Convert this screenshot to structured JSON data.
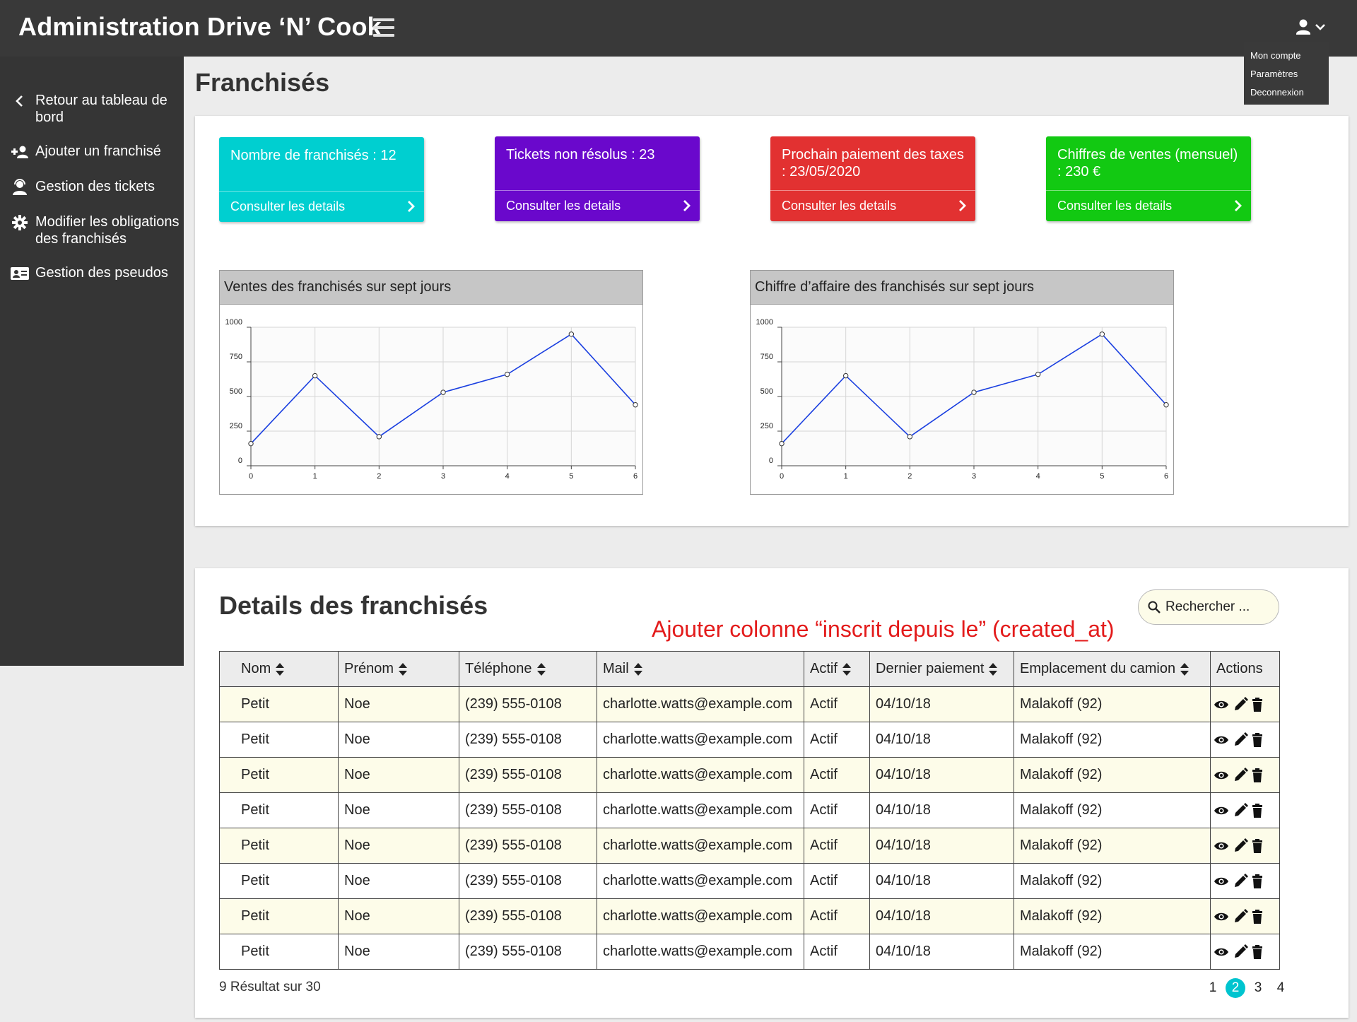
{
  "header": {
    "app_title": "Administration Drive ‘N’ Cook",
    "user_menu": [
      "Mon compte",
      "Paramètres",
      "Deconnexion"
    ]
  },
  "sidebar": {
    "items": [
      {
        "label": "Retour au tableau de bord",
        "icon": "chevron-left-icon"
      },
      {
        "label": "Ajouter un franchisé",
        "icon": "user-plus-icon"
      },
      {
        "label": "Gestion des tickets",
        "icon": "support-agent-icon"
      },
      {
        "label": "Modifier les obligations des franchisés",
        "icon": "gear-icon"
      },
      {
        "label": "Gestion des pseudos",
        "icon": "id-card-icon"
      }
    ]
  },
  "page": {
    "title": "Franchisés"
  },
  "cards": [
    {
      "title": "Nombre de franchisés : 12",
      "link": "Consulter les details",
      "color": "#00cfd0"
    },
    {
      "title": "Tickets non résolus : 23",
      "link": "Consulter les details",
      "color": "#6a08cc"
    },
    {
      "title": "Prochain paiement des taxes : 23/05/2020",
      "link": "Consulter les details",
      "color": "#e23131"
    },
    {
      "title": "Chiffres de ventes (mensuel) : 230 €",
      "link": "Consulter les details",
      "color": "#12c912"
    }
  ],
  "chart_data": [
    {
      "type": "line",
      "title": "Ventes des franchisés sur sept jours",
      "x": [
        0,
        1,
        2,
        3,
        4,
        5,
        6
      ],
      "series": [
        {
          "values": [
            160,
            650,
            210,
            530,
            660,
            950,
            440
          ]
        }
      ],
      "xlim": [
        0,
        6
      ],
      "ylim": [
        0,
        1000
      ],
      "yticks": [
        0,
        250,
        500,
        750,
        1000
      ],
      "grid": true,
      "line_color": "#1a3fe0"
    },
    {
      "type": "line",
      "title": "Chiffre d’affaire des franchisés sur sept jours",
      "x": [
        0,
        1,
        2,
        3,
        4,
        5,
        6
      ],
      "series": [
        {
          "values": [
            160,
            650,
            210,
            530,
            660,
            950,
            440
          ]
        }
      ],
      "xlim": [
        0,
        6
      ],
      "ylim": [
        0,
        1000
      ],
      "yticks": [
        0,
        250,
        500,
        750,
        1000
      ],
      "grid": true,
      "line_color": "#1a3fe0"
    }
  ],
  "details": {
    "title": "Details des franchisés",
    "annotation": "Ajouter colonne “inscrit depuis le” (created_at)",
    "search_placeholder": "Rechercher ...",
    "columns": [
      "Nom",
      "Prénom",
      "Téléphone",
      "Mail",
      "Actif",
      "Dernier paiement",
      "Emplacement du camion",
      "Actions"
    ],
    "rows": [
      [
        "Petit",
        "Noe",
        "(239) 555-0108",
        "charlotte.watts@example.com",
        "Actif",
        "04/10/18",
        "Malakoff (92)"
      ],
      [
        "Petit",
        "Noe",
        "(239) 555-0108",
        "charlotte.watts@example.com",
        "Actif",
        "04/10/18",
        "Malakoff (92)"
      ],
      [
        "Petit",
        "Noe",
        "(239) 555-0108",
        "charlotte.watts@example.com",
        "Actif",
        "04/10/18",
        "Malakoff (92)"
      ],
      [
        "Petit",
        "Noe",
        "(239) 555-0108",
        "charlotte.watts@example.com",
        "Actif",
        "04/10/18",
        "Malakoff (92)"
      ],
      [
        "Petit",
        "Noe",
        "(239) 555-0108",
        "charlotte.watts@example.com",
        "Actif",
        "04/10/18",
        "Malakoff (92)"
      ],
      [
        "Petit",
        "Noe",
        "(239) 555-0108",
        "charlotte.watts@example.com",
        "Actif",
        "04/10/18",
        "Malakoff (92)"
      ],
      [
        "Petit",
        "Noe",
        "(239) 555-0108",
        "charlotte.watts@example.com",
        "Actif",
        "04/10/18",
        "Malakoff (92)"
      ],
      [
        "Petit",
        "Noe",
        "(239) 555-0108",
        "charlotte.watts@example.com",
        "Actif",
        "04/10/18",
        "Malakoff (92)"
      ]
    ],
    "results_text": "9 Résultat sur 30",
    "pages": [
      "1",
      "2",
      "3",
      "4"
    ],
    "current_page": "2"
  }
}
